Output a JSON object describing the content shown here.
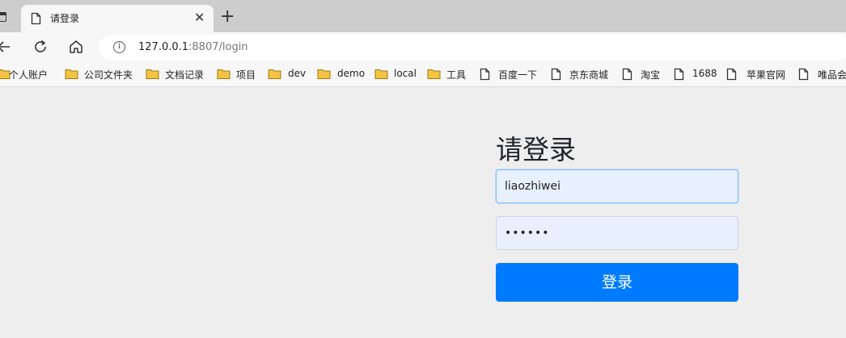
{
  "browser": {
    "tab_title": "请登录",
    "url_host": "127.0.0.1",
    "url_path": ":8807/login",
    "bookmarks": [
      {
        "label": "个人账户",
        "icon": "folder-icon"
      },
      {
        "label": "公司文件夹",
        "icon": "folder-icon"
      },
      {
        "label": "文档记录",
        "icon": "folder-icon"
      },
      {
        "label": "项目",
        "icon": "folder-icon"
      },
      {
        "label": "dev",
        "icon": "folder-icon"
      },
      {
        "label": "demo",
        "icon": "folder-icon"
      },
      {
        "label": "local",
        "icon": "folder-icon"
      },
      {
        "label": "工具",
        "icon": "folder-icon"
      },
      {
        "label": "百度一下",
        "icon": "page-icon"
      },
      {
        "label": "京东商城",
        "icon": "page-icon"
      },
      {
        "label": "淘宝",
        "icon": "page-icon"
      },
      {
        "label": "1688",
        "icon": "page-icon"
      },
      {
        "label": "苹果官网",
        "icon": "page-icon"
      },
      {
        "label": "唯品会",
        "icon": "page-icon"
      }
    ]
  },
  "login": {
    "title": "请登录",
    "username_value": "liaozhiwei",
    "password_mask": "••••••",
    "submit_label": "登录"
  },
  "colors": {
    "primary": "#007bff",
    "input_bg": "#e8f0fe",
    "page_bg": "#eeeeee",
    "folder": "#f3c443"
  }
}
